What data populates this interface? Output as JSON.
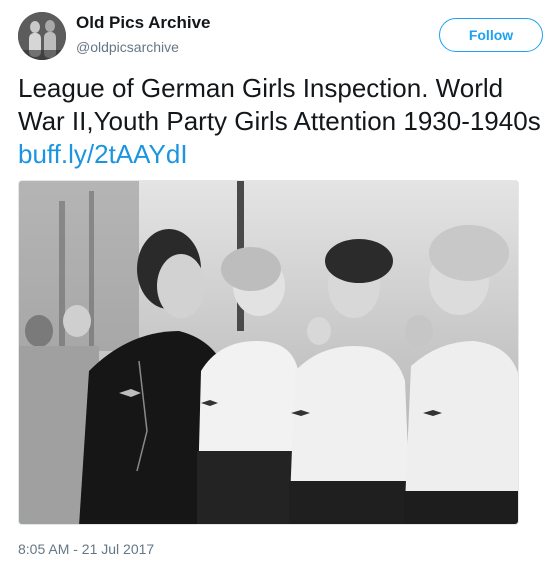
{
  "author": {
    "display_name": "Old Pics Archive",
    "handle": "@oldpicsarchive",
    "avatar_icon": "profile-photo"
  },
  "follow_button": {
    "label": "Follow",
    "color": "#1da1f2"
  },
  "tweet": {
    "text": "League of German Girls Inspection. World War II,Youth Party Girls Attention 1930-1940s ",
    "link_text": "buff.ly/2tAAYdI",
    "link_color": "#1b95e0"
  },
  "media": {
    "kind": "black-and-white photograph"
  },
  "meta": {
    "timestamp": "8:05 AM - 21 Jul 2017"
  }
}
